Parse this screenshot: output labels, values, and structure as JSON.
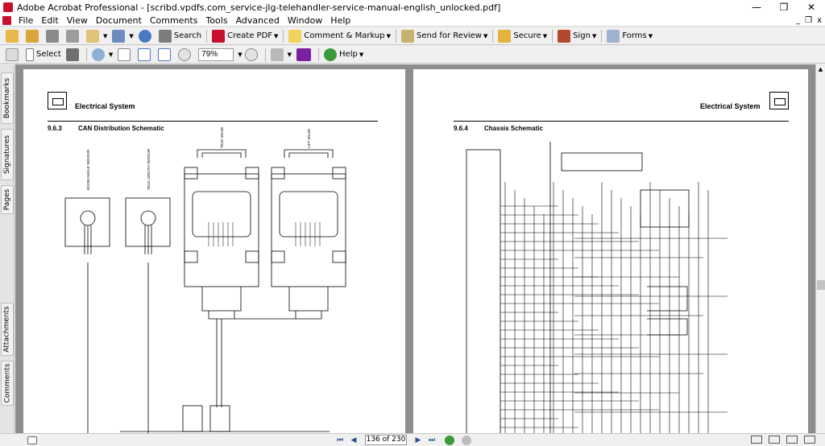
{
  "window": {
    "title": "Adobe Acrobat Professional - [scribd.vpdfs.com_service-jlg-telehandler-service-manual-english_unlocked.pdf]",
    "controls": [
      "—",
      "❐",
      "✕"
    ]
  },
  "menu": {
    "items": [
      "File",
      "Edit",
      "View",
      "Document",
      "Comments",
      "Tools",
      "Advanced",
      "Window",
      "Help"
    ],
    "doc_controls": [
      "_",
      "❐",
      "x"
    ]
  },
  "toolbar1": {
    "search_label": "Search",
    "create_pdf_label": "Create PDF",
    "comment_label": "Comment & Markup",
    "send_review_label": "Send for Review",
    "secure_label": "Secure",
    "sign_label": "Sign",
    "forms_label": "Forms"
  },
  "toolbar2": {
    "select_label": "Select",
    "zoom_value": "79%",
    "help_label": "Help"
  },
  "side_tabs": [
    "Bookmarks",
    "Signatures",
    "Pages",
    "Attachments",
    "Comments"
  ],
  "pages": {
    "left": {
      "header": "Electrical System",
      "section_number": "9.6.3",
      "section_title": "CAN Distribution Schematic",
      "labels": [
        "BOOM ANGLE SENSOR",
        "TELE LENGTH SENSOR",
        "TELE VALVE",
        "LIFT VALVE"
      ]
    },
    "right": {
      "header": "Electrical System",
      "section_number": "9.6.4",
      "section_title": "Chassis Schematic"
    }
  },
  "status": {
    "page_indicator": "136 of 230"
  },
  "colors": {
    "adobe_red": "#c8102e",
    "nav_blue": "#2a4d8f",
    "viewer_gray": "#8d8d8d"
  }
}
